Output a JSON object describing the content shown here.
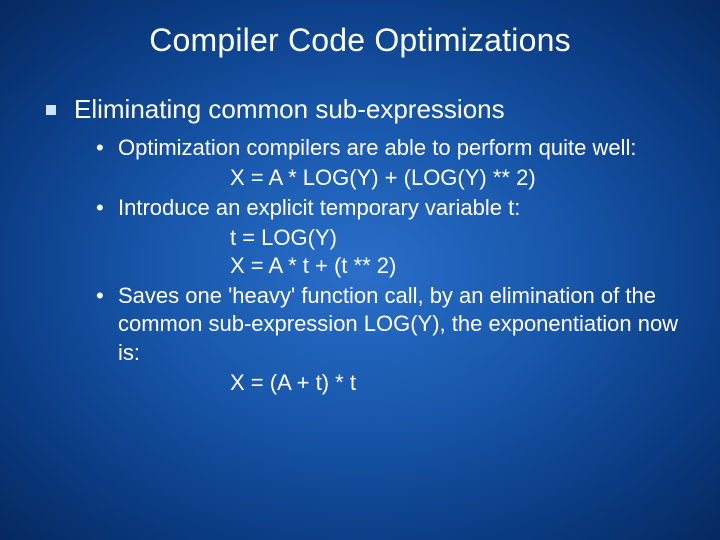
{
  "slide": {
    "title": "Compiler Code Optimizations",
    "topic": "Eliminating common sub-expressions",
    "points": [
      {
        "text": "Optimization compilers are able to perform quite well:",
        "code": [
          "X = A * LOG(Y) + (LOG(Y) ** 2)"
        ]
      },
      {
        "text": "Introduce an explicit temporary variable t:",
        "code": [
          "t = LOG(Y)",
          "X = A * t + (t ** 2)"
        ]
      },
      {
        "text": "Saves one 'heavy' function call, by an elimination of the common sub-expression LOG(Y), the exponentiation now is:",
        "code": [
          "X = (A + t) * t"
        ]
      }
    ]
  }
}
